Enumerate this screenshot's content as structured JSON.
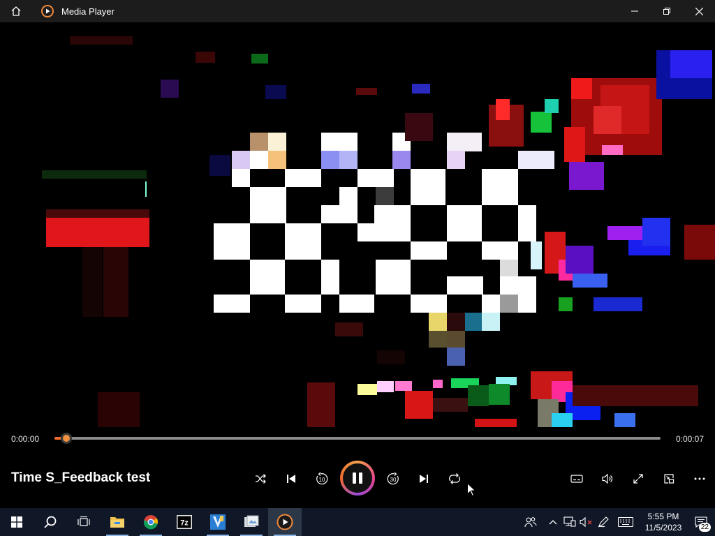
{
  "window": {
    "app_title": "Media Player"
  },
  "playback": {
    "elapsed": "0:00:00",
    "duration": "0:00:07",
    "progress_fraction": 0.02,
    "media_title": "Time S_Feedback test",
    "state": "playing",
    "skip_back_seconds": "10",
    "skip_forward_seconds": "30"
  },
  "taskbar": {
    "clock_time": "5:55 PM",
    "clock_date": "11/5/2023",
    "notification_count": "22",
    "apps": [
      "start",
      "search",
      "task-view",
      "file-explorer",
      "chrome",
      "7zip",
      "app-v",
      "app-photos",
      "media-player"
    ]
  },
  "colors": {
    "accent": "#f06a2c",
    "titlebar": "#1c1c1c",
    "taskbar": "#101828"
  }
}
